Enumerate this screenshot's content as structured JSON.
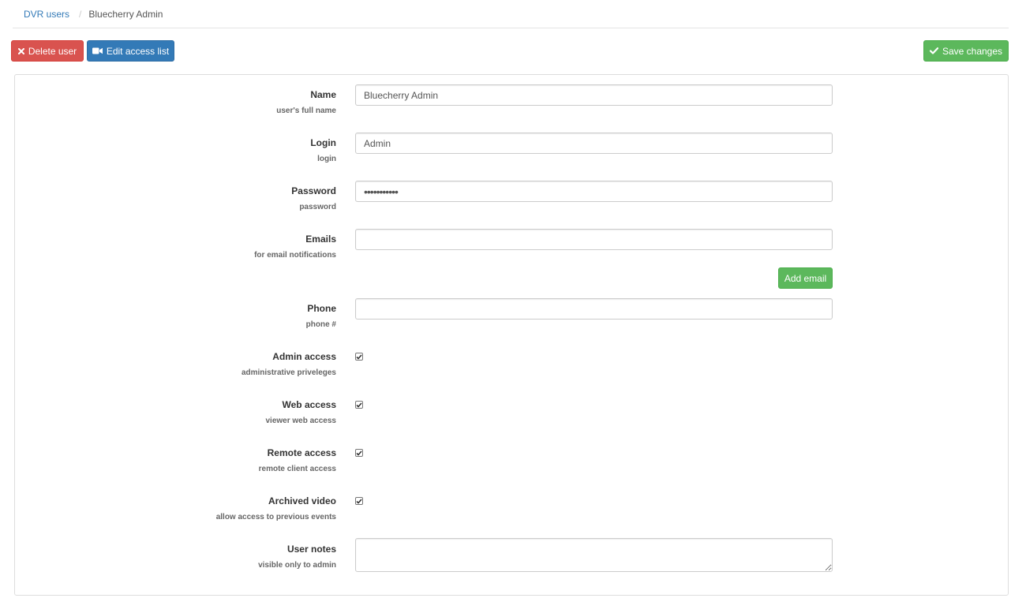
{
  "breadcrumb": {
    "parent": "DVR users",
    "current": "Bluecherry Admin"
  },
  "toolbar": {
    "delete_label": "Delete user",
    "edit_access_label": "Edit access list",
    "save_label": "Save changes"
  },
  "form": {
    "name": {
      "label": "Name",
      "hint": "user's full name",
      "value": "Bluecherry Admin"
    },
    "login": {
      "label": "Login",
      "hint": "login",
      "value": "Admin"
    },
    "password": {
      "label": "Password",
      "hint": "password",
      "value": "•••••••••••"
    },
    "emails": {
      "label": "Emails",
      "hint": "for email notifications",
      "value": "",
      "add_label": "Add email"
    },
    "phone": {
      "label": "Phone",
      "hint": "phone #",
      "value": ""
    },
    "admin_access": {
      "label": "Admin access",
      "hint": "administrative priveleges",
      "checked": true
    },
    "web_access": {
      "label": "Web access",
      "hint": "viewer web access",
      "checked": true
    },
    "remote_access": {
      "label": "Remote access",
      "hint": "remote client access",
      "checked": true
    },
    "archived_video": {
      "label": "Archived video",
      "hint": "allow access to previous events",
      "checked": true
    },
    "user_notes": {
      "label": "User notes",
      "hint": "visible only to admin",
      "value": ""
    }
  },
  "colors": {
    "danger": "#d9534f",
    "primary": "#337ab7",
    "success": "#5cb85c",
    "link": "#337ab7"
  }
}
